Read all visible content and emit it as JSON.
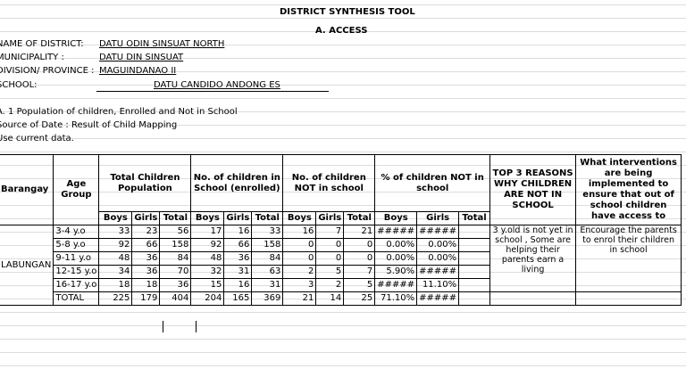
{
  "title": "DISTRICT SYNTHESIS TOOL",
  "subtitle": "A. ACCESS",
  "info": [
    {
      "label": "NAME OF DISTRICT:",
      "value": "DATU ODIN SINSUAT NORTH"
    },
    {
      "label": "MUNICIPALITY :",
      "value": "DATU DIN SINSUAT"
    },
    {
      "label": "DIVISION/ PROVINCE :",
      "value": "MAGUINDANAO II"
    },
    {
      "label": "SCHOOL:",
      "value": "DATU CANDIDO ANDONG ES"
    }
  ],
  "notes": [
    "A. 1 Population of children, Enrolled and Not in School",
    "Source of Date : Result of Child Mapping",
    "Use current data."
  ],
  "headers": {
    "barangay": "Barangay",
    "age_group": "Age Group",
    "total_pop": "Total Children Population",
    "enrolled": "No. of children in School (enrolled)",
    "not_in_school": "No. of children NOT in school",
    "pct_not": "% of children NOT in school",
    "top3": "TOP 3 REASONS WHY CHILDREN ARE NOT IN SCHOOL",
    "interventions": "What interventions are being implemented to ensure that out of school children have access to"
  },
  "sub": [
    "Boys",
    "Girls",
    "Total",
    "Boys",
    "Girls",
    "Total",
    "Boys",
    "Girls",
    "Total",
    "Boys",
    "Girls",
    "Total"
  ],
  "barangay": "LABUNGAN",
  "rows": [
    {
      "age": "3-4 y.o",
      "v": [
        "33",
        "23",
        "56",
        "17",
        "16",
        "33",
        "16",
        "7",
        "21",
        "#####",
        "#####"
      ]
    },
    {
      "age": "5-8 y.o",
      "v": [
        "92",
        "66",
        "158",
        "92",
        "66",
        "158",
        "0",
        "0",
        "0",
        "0.00%",
        "0.00%"
      ]
    },
    {
      "age": "9-11 y.o",
      "v": [
        "48",
        "36",
        "84",
        "48",
        "36",
        "84",
        "0",
        "0",
        "0",
        "0.00%",
        "0.00%"
      ]
    },
    {
      "age": "12-15 y.o",
      "v": [
        "34",
        "36",
        "70",
        "32",
        "31",
        "63",
        "2",
        "5",
        "7",
        "5.90%",
        "#####"
      ]
    },
    {
      "age": "16-17 y.o",
      "v": [
        "18",
        "18",
        "36",
        "15",
        "16",
        "31",
        "3",
        "2",
        "5",
        "#####",
        "11.10%"
      ]
    },
    {
      "age": "TOTAL",
      "v": [
        "225",
        "179",
        "404",
        "204",
        "165",
        "369",
        "21",
        "14",
        "25",
        "71.10%",
        "#####"
      ]
    }
  ],
  "reason_text": "3 y.old is not yet in school , Some are helping their parents earn a living",
  "intervention_text": "Encourage the parents to enrol their children in school"
}
